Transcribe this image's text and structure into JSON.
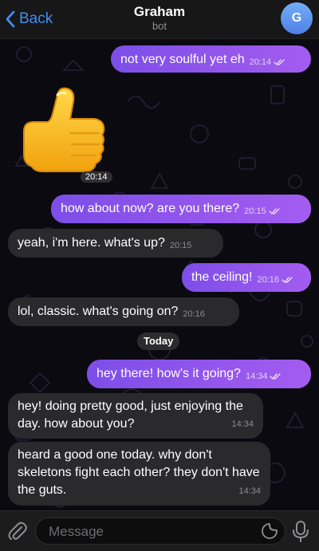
{
  "header": {
    "back_label": "Back",
    "title": "Graham",
    "subtitle": "bot",
    "avatar_letter": "G"
  },
  "messages": [
    {
      "id": "m1",
      "dir": "out",
      "text": "not very soulful yet eh",
      "time": "20:14",
      "read": true
    },
    {
      "id": "m2",
      "type": "sticker",
      "sticker": "thumbs-up",
      "time": "20:14"
    },
    {
      "id": "m3",
      "dir": "out",
      "text": "how about now? are you there?",
      "time": "20:15",
      "read": true
    },
    {
      "id": "m4",
      "dir": "in",
      "text": "yeah, i'm here. what's up?",
      "time": "20:15"
    },
    {
      "id": "m5",
      "dir": "out",
      "text": "the ceiling!",
      "time": "20:16",
      "read": true
    },
    {
      "id": "m6",
      "dir": "in",
      "text": "lol, classic. what's going on?",
      "time": "20:16"
    },
    {
      "id": "m7",
      "dir": "out",
      "text": "hey there! how's it going?",
      "time": "14:34",
      "read": true
    },
    {
      "id": "m8",
      "dir": "in",
      "text": "hey! doing pretty good, just enjoying the day. how about you?",
      "time": "14:34"
    },
    {
      "id": "m9",
      "dir": "in",
      "text": "heard a good one today. why don't skeletons fight each other? they don't have the guts.",
      "time": "14:34"
    }
  ],
  "date_separator": "Today",
  "input": {
    "placeholder": "Message",
    "value": ""
  },
  "colors": {
    "accent": "#3f8ff5",
    "outgoing_start": "#7d4ee8",
    "outgoing_end": "#a45cf0",
    "incoming": "#2a2a2d"
  }
}
